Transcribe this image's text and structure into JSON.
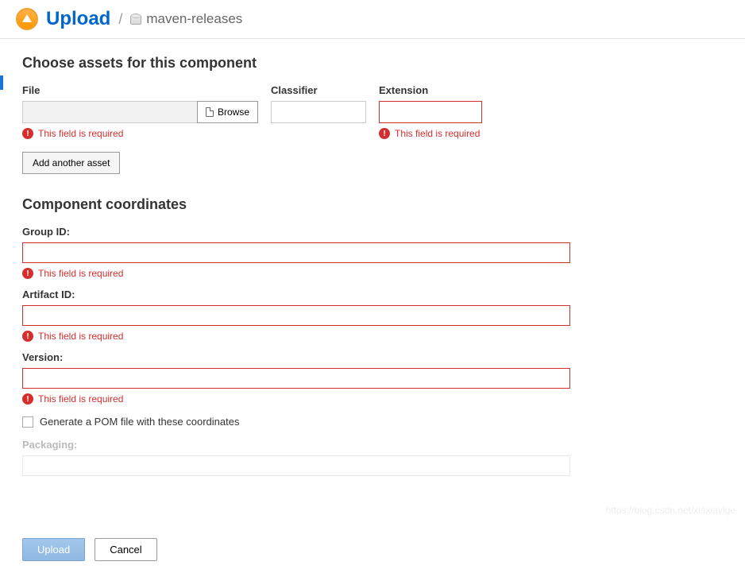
{
  "header": {
    "title": "Upload",
    "breadcrumb_repo": "maven-releases"
  },
  "assets": {
    "section_title": "Choose assets for this component",
    "file_label": "File",
    "classifier_label": "Classifier",
    "extension_label": "Extension",
    "browse_label": "Browse",
    "file_error": "This field is required",
    "extension_error": "This field is required",
    "add_another_label": "Add another asset"
  },
  "coords": {
    "section_title": "Component coordinates",
    "group_id_label": "Group ID:",
    "group_id_error": "This field is required",
    "artifact_id_label": "Artifact ID:",
    "artifact_id_error": "This field is required",
    "version_label": "Version:",
    "version_error": "This field is required",
    "generate_pom_label": "Generate a POM file with these coordinates",
    "packaging_label": "Packaging:"
  },
  "footer": {
    "upload_label": "Upload",
    "cancel_label": "Cancel"
  },
  "watermark": "https://blog.csdn.net/xiaxiayige"
}
